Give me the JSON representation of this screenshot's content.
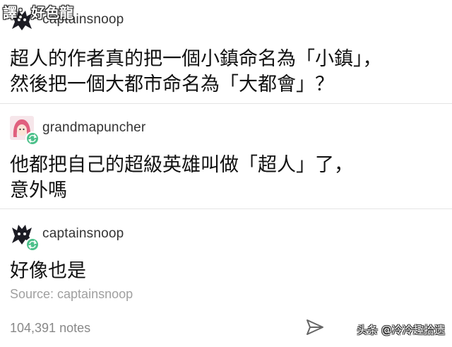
{
  "overlay": {
    "credit": "譯：好色龍"
  },
  "posts": [
    {
      "username": "captainsnoop",
      "avatar_icon": "bat-silhouette-icon",
      "text": [
        "超人的作者真的把一個小鎮命名為「小鎮」，",
        "然後把一個大都市命名為「大都會」？"
      ]
    },
    {
      "username": "grandmapuncher",
      "avatar_icon": "pink-hair-character-icon",
      "badge_icon": "reblog-icon",
      "text": [
        "他都把自己的超級英雄叫做「超人」了，",
        "意外嗎"
      ]
    },
    {
      "username": "captainsnoop",
      "avatar_icon": "bat-silhouette-icon",
      "badge_icon": "reblog-icon",
      "text": [
        "好像也是"
      ]
    }
  ],
  "footer": {
    "source": "Source: captainsnoop",
    "notes": "104,391 notes",
    "share_icon": "send-icon"
  },
  "watermark": "头条 @冷冷趣拾遗",
  "colors": {
    "reblog_badge": "#4cc08a",
    "muted_text": "#a0a0a0"
  }
}
